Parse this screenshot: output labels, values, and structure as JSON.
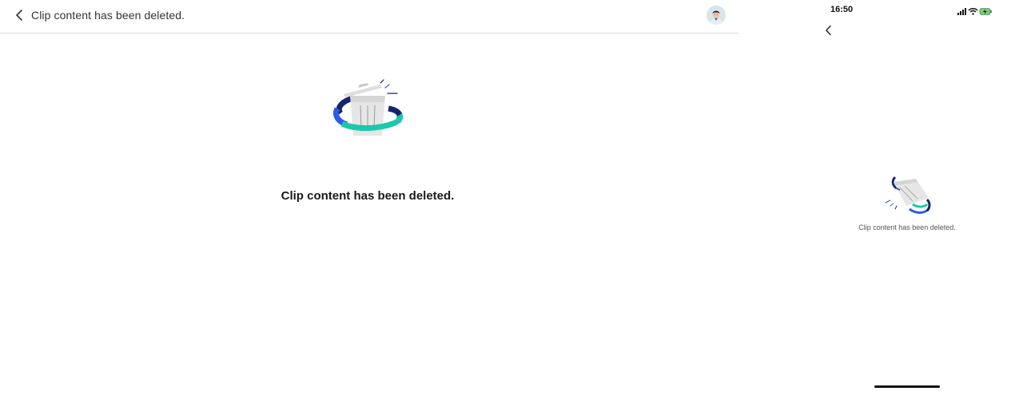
{
  "desktop": {
    "header": {
      "back_icon": "chevron-left-icon",
      "title": "Clip content has been deleted.",
      "avatar_icon": "user-avatar"
    },
    "main": {
      "illustration_icon": "deleted-trash-icon",
      "message": "Clip content has been deleted."
    }
  },
  "phone": {
    "status_bar": {
      "time": "16:50",
      "icons": [
        "signal-icon",
        "wifi-icon",
        "battery-charging-icon"
      ]
    },
    "header": {
      "back_icon": "chevron-left-icon"
    },
    "main": {
      "illustration_icon": "deleted-trash-icon",
      "message": "Clip content has been deleted."
    }
  },
  "colors": {
    "accent_teal": "#19c9a9",
    "accent_blue": "#2d5be3",
    "accent_navy": "#15256e",
    "bin_gray": "#e3e3e3",
    "divider": "#d9d9d9"
  }
}
